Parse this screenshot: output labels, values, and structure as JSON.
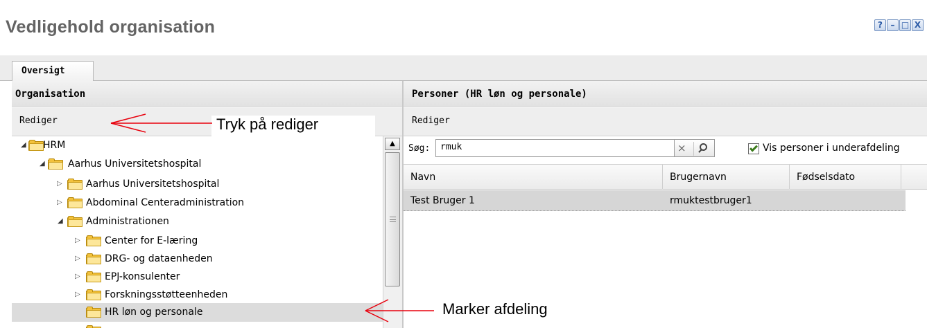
{
  "window": {
    "title": "Vedligehold organisation",
    "buttons": {
      "help": "?",
      "minimize": "–",
      "maximize": "□",
      "close": "X"
    }
  },
  "tabs": [
    {
      "label": "Oversigt"
    }
  ],
  "left_panel": {
    "header": "Organisation",
    "toolbar": {
      "edit_label": "Rediger"
    },
    "tree": [
      {
        "label": "HRM",
        "level": 0,
        "expanded": true
      },
      {
        "label": "Aarhus Universitetshospital",
        "level": 1,
        "expanded": true
      },
      {
        "label": "Aarhus Universitetshospital",
        "level": 2,
        "expanded": false
      },
      {
        "label": "Abdominal Centeradministration",
        "level": 2,
        "expanded": false
      },
      {
        "label": "Administrationen",
        "level": 2,
        "expanded": true
      },
      {
        "label": "Center for E-læring",
        "level": 3,
        "expanded": false
      },
      {
        "label": "DRG- og dataenheden",
        "level": 3,
        "expanded": false
      },
      {
        "label": "EPJ-konsulenter",
        "level": 3,
        "expanded": false
      },
      {
        "label": "Forskningsstøtteenheden",
        "level": 3,
        "expanded": false
      },
      {
        "label": "HR løn og personale",
        "level": 3,
        "selected": true
      }
    ]
  },
  "right_panel": {
    "header": "Personer (HR løn og personale)",
    "toolbar": {
      "edit_label": "Rediger"
    },
    "search": {
      "label": "Søg:",
      "value": "rmuk"
    },
    "subunits_checkbox": {
      "label": "Vis personer i underafdeling",
      "checked": true
    },
    "grid": {
      "columns": [
        "Navn",
        "Brugernavn",
        "Fødselsdato"
      ],
      "rows": [
        {
          "name": "Test Bruger 1",
          "username": "rmuktestbruger1",
          "birthdate": ""
        }
      ]
    }
  },
  "annotations": {
    "edit_hint": "Tryk på rediger",
    "select_hint": "Marker afdeling",
    "arrow_color": "#e8000d"
  }
}
